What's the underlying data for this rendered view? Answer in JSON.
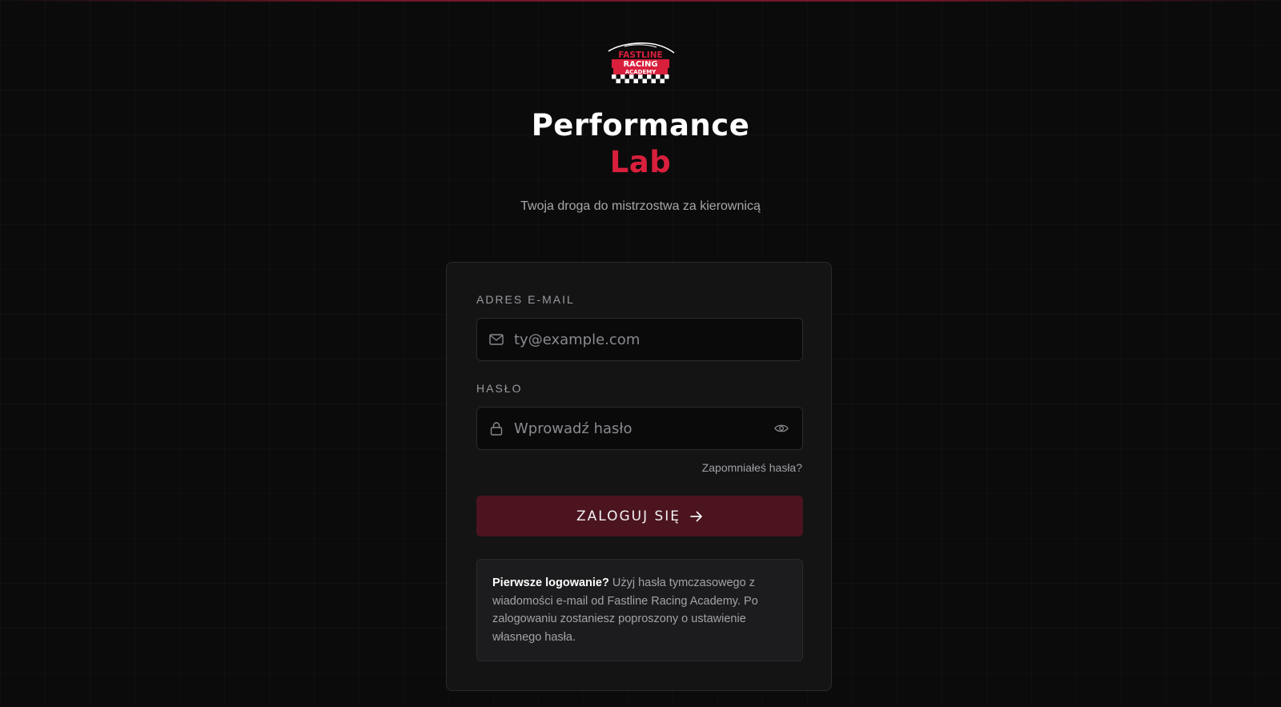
{
  "header": {
    "logo_text": [
      "FASTLINE",
      "RACING",
      "ACADEMY"
    ],
    "title_line1": "Performance",
    "title_line2": "Lab",
    "subtitle": "Twoja droga do mistrzostwa za kierownicą"
  },
  "form": {
    "email_label": "ADRES E-MAIL",
    "email_placeholder": "ty@example.com",
    "email_value": "",
    "password_label": "HASŁO",
    "password_placeholder": "Wprowadź hasło",
    "password_value": "",
    "forgot_link": "Zapomniałeś hasła?",
    "login_button": "ZALOGUJ SIĘ"
  },
  "info": {
    "bold": "Pierwsze logowanie?",
    "text": " Użyj hasła tymczasowego z wiadomości e-mail od Fastline Racing Academy. Po zalogowaniu zostaniesz poproszony o ustawienie własnego hasła."
  },
  "icons": {
    "email": "mail-icon",
    "password": "lock-icon",
    "toggle": "eye-icon",
    "submit": "arrow-right-icon"
  },
  "colors": {
    "background": "#0b0b0c",
    "accent": "#d81f3c",
    "button": "#4b141f",
    "card": "#141415"
  }
}
